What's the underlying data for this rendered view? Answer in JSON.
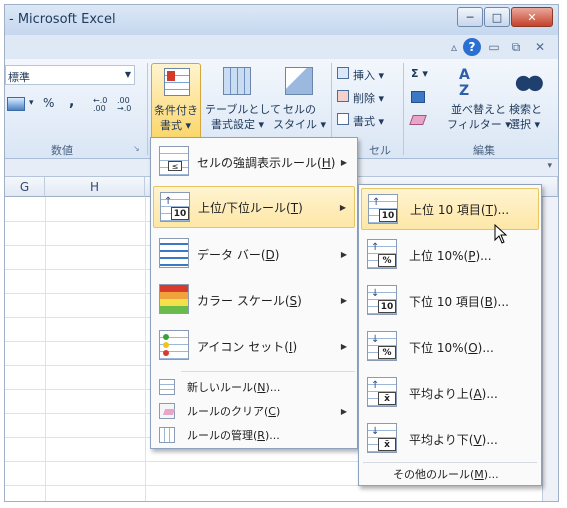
{
  "window": {
    "title": "- Microsoft Excel",
    "min": "─",
    "max": "□",
    "close": "✕"
  },
  "ribbon": {
    "number_format": "標準",
    "percent": "%",
    "comma": ",",
    "dec_inc": "←.0 .00",
    "dec_dec": ".00 →.0",
    "group_number": "数値",
    "cond_format_1": "条件付き",
    "cond_format_2": "書式 ▾",
    "table_1": "テーブルとして",
    "table_2": "書式設定 ▾",
    "cellstyle_1": "セルの",
    "cellstyle_2": "スタイル ▾",
    "insert": "挿入 ▾",
    "delete": "削除 ▾",
    "format": "書式 ▾",
    "group_cells": "セル",
    "sigma": "Σ ▾",
    "sort_1": "並べ替えと",
    "sort_2": "フィルター ▾",
    "find_1": "検索と",
    "find_2": "選択 ▾",
    "group_edit": "編集"
  },
  "sheet": {
    "col_g": "G",
    "col_h": "H"
  },
  "main_menu": {
    "items": [
      {
        "label": "セルの強調表示ルール",
        "key": "H"
      },
      {
        "label": "上位/下位ルール",
        "key": "T"
      },
      {
        "label": "データ バー",
        "key": "D"
      },
      {
        "label": "カラー スケール",
        "key": "S"
      },
      {
        "label": "アイコン セット",
        "key": "I"
      }
    ],
    "small_items": [
      {
        "label": "新しいルール",
        "key": "N",
        "suffix": "..."
      },
      {
        "label": "ルールのクリア",
        "key": "C",
        "suffix": ""
      },
      {
        "label": "ルールの管理",
        "key": "R",
        "suffix": "..."
      }
    ]
  },
  "sub_menu": {
    "items": [
      {
        "label": "上位 10 項目",
        "key": "T",
        "icon_text": "10"
      },
      {
        "label": "上位 10%",
        "key": "P",
        "icon_text": "%"
      },
      {
        "label": "下位 10 項目",
        "key": "B",
        "icon_text": "10"
      },
      {
        "label": "下位 10%",
        "key": "O",
        "icon_text": "%"
      },
      {
        "label": "平均より上",
        "key": "A",
        "icon_text": "x̄"
      },
      {
        "label": "平均より下",
        "key": "V",
        "icon_text": "x̄"
      }
    ],
    "more": {
      "label": "その他のルール",
      "key": "M"
    }
  },
  "colors": {
    "highlight": "#fde7a6",
    "accent": "#1e395b"
  }
}
